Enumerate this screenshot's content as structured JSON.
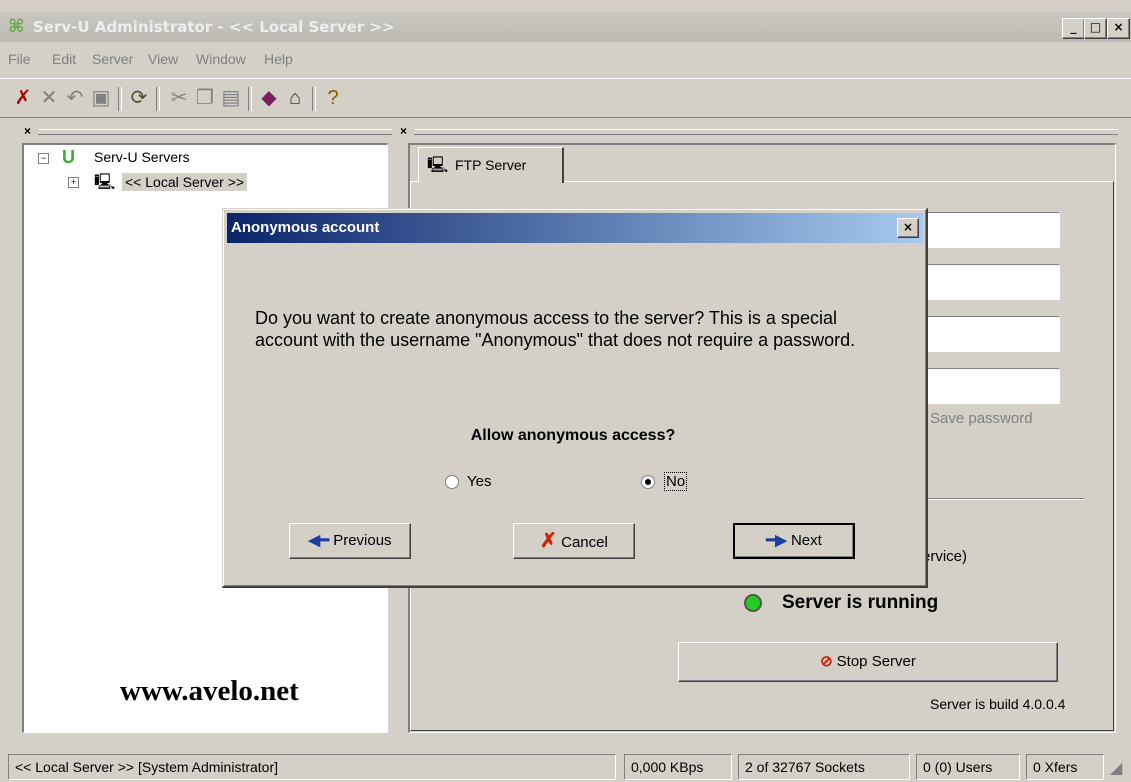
{
  "window": {
    "title": "Serv-U Administrator - << Local Server >>"
  },
  "menu": [
    "File",
    "Edit",
    "Server",
    "View",
    "Window",
    "Help"
  ],
  "toolbar_icons": [
    "disconnect-icon",
    "delete-icon",
    "undo-icon",
    "save-icon",
    "refresh-icon",
    "cut-icon",
    "copy-icon",
    "paste-icon",
    "book-icon",
    "home-icon",
    "help-icon"
  ],
  "left_pane": {
    "tree_root": "Serv-U Servers",
    "tree_child": "<< Local Server >>",
    "watermark": "www.avelo.net"
  },
  "right_pane": {
    "tab_label": "FTP Server",
    "save_password": "Save password",
    "service_fragment": "ervice)",
    "status_text": "Server is running",
    "stop_button": "Stop Server",
    "build_text": "Server is build 4.0.0.4"
  },
  "dialog": {
    "title": "Anonymous account",
    "message": "Do you want to create anonymous access to the server? This is a special account with the username \"Anonymous\" that does not require a password.",
    "question": "Allow anonymous access?",
    "yes_label": "Yes",
    "no_label": "No",
    "selected": "No",
    "previous_button": "Previous",
    "cancel_button": "Cancel",
    "next_button": "Next"
  },
  "statusbar": {
    "server": "<< Local Server >>  [System Administrator]",
    "speed": "0,000 KBps",
    "sockets": "2 of 32767 Sockets",
    "users": "0 (0) Users",
    "xfers": "0 Xfers"
  },
  "colors": {
    "dialog_title_start": "#0a246a",
    "dialog_title_end": "#a6caf0",
    "status_ok": "#22cc22",
    "cancel_icon": "#cc2200",
    "arrow_icon": "#1a3fa0"
  }
}
